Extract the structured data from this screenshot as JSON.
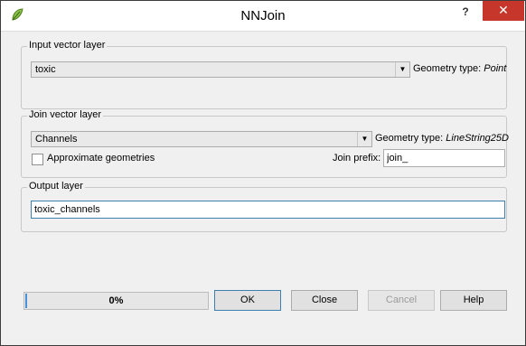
{
  "window": {
    "title": "NNJoin",
    "help_button": "?",
    "close_button": "✕"
  },
  "input_group": {
    "title": "Input vector layer",
    "layer_value": "toxic",
    "geometry_label": "Geometry type:",
    "geometry_value": "Point"
  },
  "join_group": {
    "title": "Join vector layer",
    "layer_value": "Channels",
    "geometry_label": "Geometry type:",
    "geometry_value": "LineString25D",
    "approx_label": "Approximate geometries",
    "approx_checked": false,
    "prefix_label": "Join prefix:",
    "prefix_value": "join_"
  },
  "output_group": {
    "title": "Output layer",
    "output_value": "toxic_channels"
  },
  "progress": {
    "value_text": "0%",
    "value": 0
  },
  "buttons": {
    "ok": "OK",
    "close": "Close",
    "cancel": "Cancel",
    "help": "Help"
  },
  "icons": {
    "app": "qgis-leaf-icon",
    "dropdown": "chevron-down-icon"
  },
  "colors": {
    "close_button_bg": "#c7362a",
    "focus_border": "#3c7fb1",
    "window_bg": "#f0f0f0"
  }
}
